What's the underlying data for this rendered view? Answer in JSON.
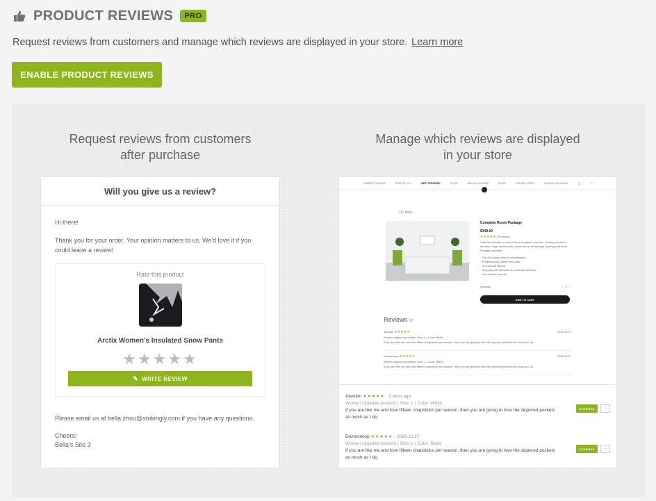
{
  "header": {
    "title": "PRODUCT REVIEWS",
    "badge": "PRO",
    "description": "Request reviews from customers and manage which reviews are displayed in your store.",
    "learn_more": "Learn more",
    "enable_button": "ENABLE PRODUCT REVIEWS"
  },
  "left_column": {
    "title_line1": "Request reviews from customers",
    "title_line2": "after purchase",
    "email": {
      "heading": "Will you give us a review?",
      "greeting": "Hi there!",
      "message": "Thank you for your order. Your opinion matters to us. We'd love it if you could leave a review!",
      "rate_label": "Rate this product",
      "product_name": "Arctix Women's Insulated Snow Pants",
      "stars": "★★★★★",
      "write_review": "WRITE REVIEW",
      "contact": "Please email us at bella.zhou@strikingly.com if you have any questions.",
      "signoff1": "Cheers!",
      "signoff2": "Bella's Site 3"
    }
  },
  "right_column": {
    "title_line1": "Manage which reviews are displayed",
    "title_line2": "in your store",
    "store": {
      "nav": [
        "SUMMIT PRIMER",
        "PORTFOLIO",
        "GET STARTED",
        "FAQS",
        "ABOUT LEANNE",
        "BLOG",
        "SOCIAL FEED",
        "SIMPLE PACKAGE"
      ],
      "back": "← Go Back",
      "product_title": "Complete Room Package",
      "price": "$349.00",
      "rating": "★★★★★",
      "rating_count": "75 reviews",
      "description": "Start from scratch or view it as a complete overhaul. I'll help you select furniture, rugs, accessories, paint colors, furnishings, lighting and more. Package includes:",
      "bullets": "· Two 45-minute phone consultations\n· Professionally-drawn floor plan\n· 3 Lookbook Report\n· Shopping list with links to purchase all items\n· Two revision rounds",
      "quantity_label": "Quantity",
      "quantity_value": "1",
      "add_to_cart": "ADD TO CART",
      "reviews_heading": "Reviews",
      "reviews_count": "55",
      "mini_reviews": [
        {
          "name": "Alexdim",
          "stars": "★★★★★",
          "date": "2019.12.27",
          "meta": "Women zippered pockets  |  Size: L  |  Color: White",
          "text": "If you are like me and lose fifteen chapsticks per season, then you are going to love the zippered pockets as much as I do."
        },
        {
          "name": "Dominoloop",
          "stars": "★★★★★",
          "date": "2019.12.27",
          "meta": "Women zippered pockets  |  Size: L  |  Color: Black",
          "text": "If you are like me and lose fifteen chapsticks per season, then you are going to love the zippered pockets as much as I do."
        }
      ]
    },
    "admin_reviews": [
      {
        "name": "Alexdim",
        "stars": "★★★★★",
        "ago": "2 mins ago",
        "meta": "Women zippered pockets  |  Size: L  |  Color: White",
        "text": "If you are like me and lose fifteen chapsticks per season, then you are going to love the zippered pockets as much as I do.",
        "approve": "APPROVE",
        "more": "···"
      },
      {
        "name": "Dominoloop",
        "stars": "★★★★★",
        "ago": "2019.12.27",
        "meta": "Women zippered pockets  |  Size: L  |  Color: Black",
        "text": "If you are like me and lose fifteen chapsticks per season, then you are going to love the zippered pockets as much as I do.",
        "approve": "APPROVE",
        "more": "···"
      }
    ]
  },
  "colors": {
    "accent": "#8fb51d",
    "text": "#4b5056",
    "background": "#f4f4f4"
  }
}
